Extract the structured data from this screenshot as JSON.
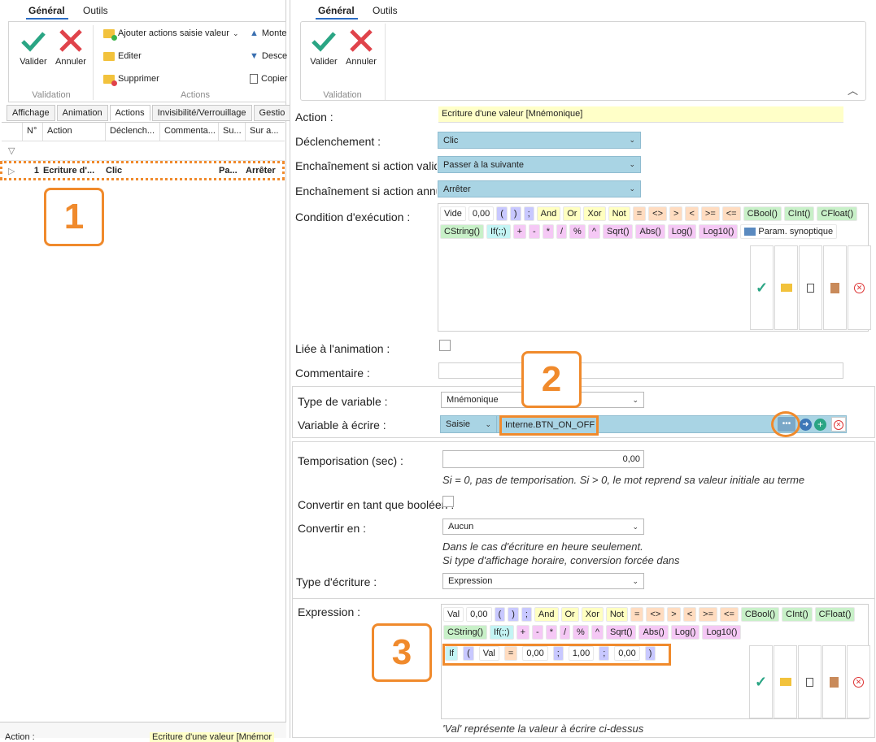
{
  "left": {
    "tabs": [
      "Général",
      "Outils"
    ],
    "ribbon": {
      "validate": "Valider",
      "cancel": "Annuler",
      "group_validation": "Validation",
      "add_actions": "Ajouter actions saisie valeur",
      "edit": "Editer",
      "delete": "Supprimer",
      "group_actions": "Actions",
      "move_up": "Monte",
      "move_down": "Desce",
      "copy": "Copier"
    },
    "prop_tabs": [
      "Affichage",
      "Animation",
      "Actions",
      "Invisibilité/Verrouillage",
      "Gestio"
    ],
    "grid": {
      "headers": [
        "N°",
        "Action",
        "Déclench...",
        "Commenta...",
        "Su...",
        "Sur a..."
      ],
      "row": {
        "num": "1",
        "action": "Ecriture d'...",
        "trigger": "Clic",
        "comment": "",
        "su": "Pa...",
        "sur": "Arrêter"
      }
    },
    "bottom_left": "Action :",
    "bottom_right": "Ecriture d'une valeur [Mnémor"
  },
  "right": {
    "tabs": [
      "Général",
      "Outils"
    ],
    "ribbon": {
      "validate": "Valider",
      "cancel": "Annuler",
      "group_validation": "Validation"
    },
    "labels": {
      "action": "Action :",
      "trigger": "Déclenchement :",
      "on_valid": "Enchaînement si action validée :",
      "on_cancel": "Enchaînement si action annulée :",
      "condition": "Condition d'exécution :",
      "linked": "Liée à l'animation :",
      "comment": "Commentaire :",
      "var_type": "Type de variable :",
      "var_write": "Variable à écrire :",
      "timer": "Temporisation (sec) :",
      "bool": "Convertir en tant que booléen :",
      "convert": "Convertir en :",
      "write_type": "Type d'écriture :",
      "expression": "Expression :"
    },
    "values": {
      "action": "Ecriture d'une valeur [Mnémonique]",
      "trigger": "Clic",
      "on_valid": "Passer à la suivante",
      "on_cancel": "Arrêter",
      "var_type": "Mnémonique",
      "var_mode": "Saisie",
      "var_name": "Interne.BTN_ON_OFF",
      "timer": "0,00",
      "convert": "Aucun",
      "write_type": "Expression"
    },
    "notes": {
      "timer": "Si = 0, pas de temporisation. Si > 0, le mot reprend sa valeur initiale au terme",
      "convert1": "Dans le cas d'écriture en heure seulement.",
      "convert2": "Si type d'affichage horaire, conversion forcée dans",
      "val": "'Val' représente la valeur à écrire ci-dessus"
    },
    "cond_tokens_row1": [
      "Vide",
      "0,00",
      "(",
      ")",
      ";",
      "And",
      "Or",
      "Xor",
      "Not",
      "=",
      "<>",
      ">",
      "<",
      ">=",
      "<=",
      "CBool()",
      "CInt()",
      "CFloat()"
    ],
    "cond_tokens_row2": [
      "CString()",
      "If(;;)",
      "+",
      "-",
      "*",
      "/",
      "%",
      "^",
      "Sqrt()",
      "Abs()",
      "Log()",
      "Log10()",
      "Param. synoptique"
    ],
    "expr_tokens_row1": [
      "Val",
      "0,00",
      "(",
      ")",
      ";",
      "And",
      "Or",
      "Xor",
      "Not",
      "=",
      "<>",
      ">",
      "<",
      ">=",
      "<=",
      "CBool()",
      "CInt()",
      "CFloat()"
    ],
    "expr_tokens_row2": [
      "CString()",
      "If(;;)",
      "+",
      "-",
      "*",
      "/",
      "%",
      "^",
      "Sqrt()",
      "Abs()",
      "Log()",
      "Log10()"
    ],
    "expr_content": [
      "If",
      "(",
      "Val",
      "=",
      "0,00",
      ";",
      "1,00",
      ";",
      "0,00",
      ")"
    ]
  },
  "callouts": [
    "1",
    "2",
    "3"
  ],
  "colors": {
    "accent_orange": "#f08a2c",
    "combo_blue": "#a9d4e4",
    "check_green": "#2aa584",
    "cross_red": "#e0434b"
  }
}
